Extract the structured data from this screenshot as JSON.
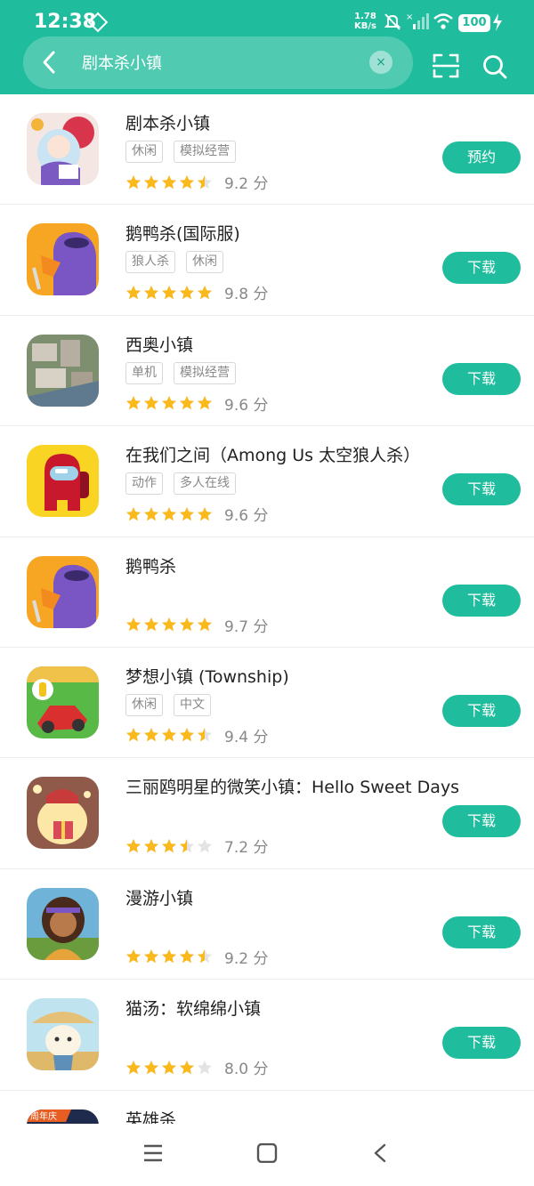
{
  "status": {
    "time": "12:38",
    "speed_value": "1.78",
    "speed_unit": "KB/s",
    "battery": "100"
  },
  "search": {
    "query": "剧本杀小镇",
    "clear_symbol": "×"
  },
  "colors": {
    "accent": "#1fbd9d",
    "star": "#f9b81b",
    "star_empty": "#e3e3e3"
  },
  "results": [
    {
      "name": "剧本杀小镇",
      "tags": [
        "休闲",
        "模拟经营"
      ],
      "rating": 4.5,
      "score": "9.2 分",
      "button": "预约"
    },
    {
      "name": "鹅鸭杀(国际服)",
      "tags": [
        "狼人杀",
        "休闲"
      ],
      "rating": 5,
      "score": "9.8 分",
      "button": "下载"
    },
    {
      "name": "西奥小镇",
      "tags": [
        "单机",
        "模拟经营"
      ],
      "rating": 5,
      "score": "9.6 分",
      "button": "下载"
    },
    {
      "name": "在我们之间（Among Us 太空狼人杀）",
      "tags": [
        "动作",
        "多人在线"
      ],
      "rating": 5,
      "score": "9.6 分",
      "button": "下载"
    },
    {
      "name": "鹅鸭杀",
      "tags": [],
      "rating": 5,
      "score": "9.7 分",
      "button": "下载"
    },
    {
      "name": "梦想小镇 (Township)",
      "tags": [
        "休闲",
        "中文"
      ],
      "rating": 4.5,
      "score": "9.4 分",
      "button": "下载"
    },
    {
      "name": "三丽鸥明星的微笑小镇：Hello Sweet Days",
      "tags": [],
      "rating": 3.5,
      "score": "7.2 分",
      "button": "下载"
    },
    {
      "name": "漫游小镇",
      "tags": [],
      "rating": 4.5,
      "score": "9.2 分",
      "button": "下载"
    },
    {
      "name": "猫汤：软绵绵小镇",
      "tags": [],
      "rating": 4,
      "score": "8.0 分",
      "button": "下载"
    },
    {
      "name": "英雄杀",
      "tags": [],
      "rating": 0,
      "score": "",
      "button": ""
    }
  ],
  "icons": [
    "app-icon-jubensha",
    "app-icon-goose-global",
    "app-icon-theotown",
    "app-icon-among-us",
    "app-icon-goose",
    "app-icon-township",
    "app-icon-sanrio",
    "app-icon-wandering",
    "app-icon-cat-soup",
    "app-icon-hero-kill"
  ],
  "icon_badge": "周年庆"
}
